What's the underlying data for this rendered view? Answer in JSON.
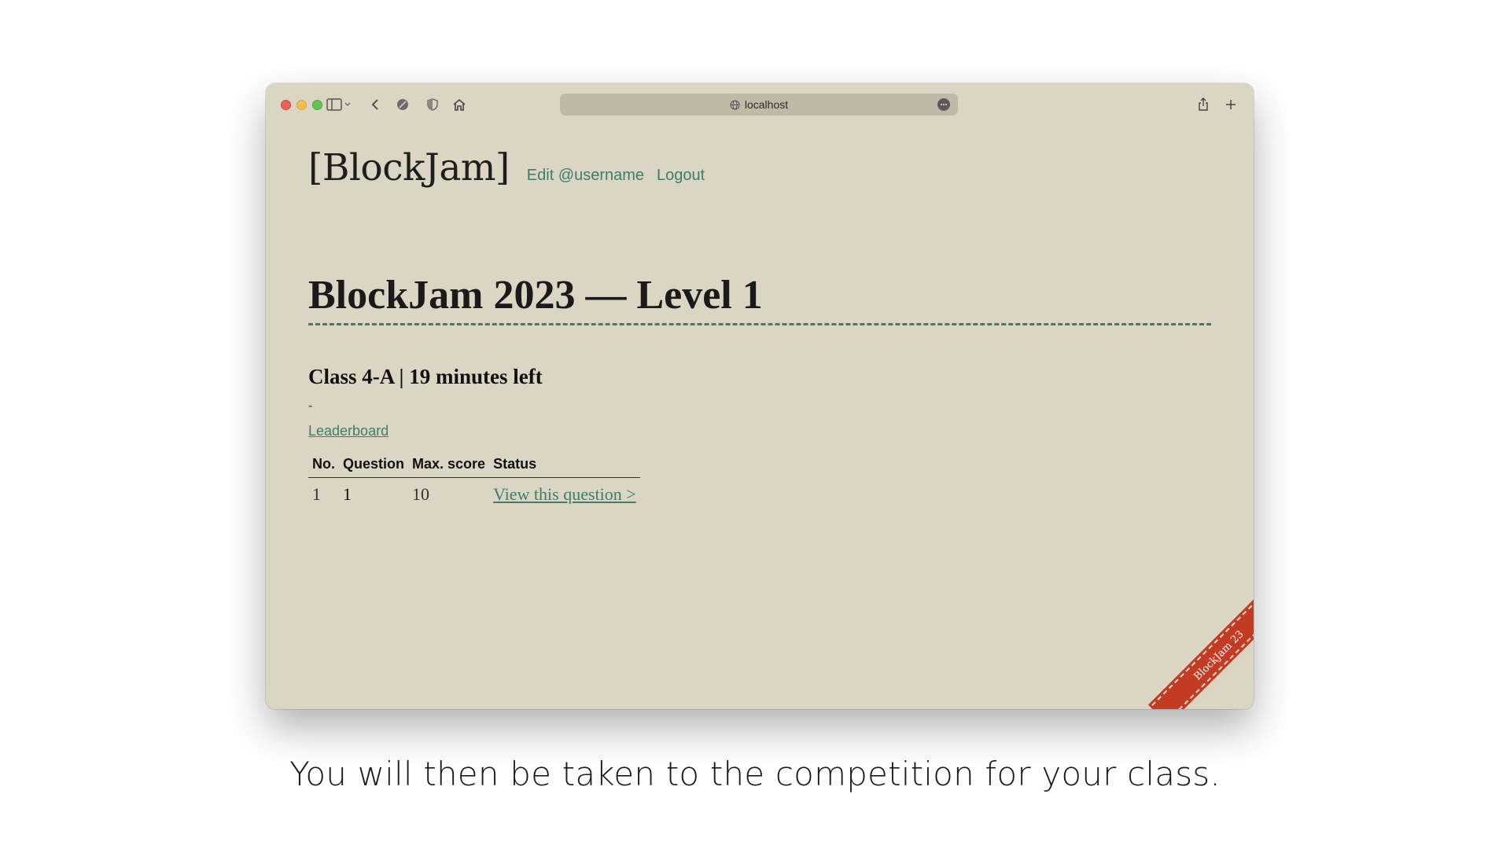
{
  "browser": {
    "address": "localhost",
    "icons": [
      "sidebar-icon",
      "chevron-down-icon",
      "back-icon",
      "blocked-icon",
      "shield-icon",
      "home-icon",
      "globe-icon",
      "more-icon",
      "share-icon",
      "plus-icon"
    ]
  },
  "site": {
    "logo": "[BlockJam]",
    "nav": [
      {
        "label": "Edit @username"
      },
      {
        "label": "Logout"
      }
    ]
  },
  "page": {
    "title": "BlockJam 2023 — Level 1",
    "subtitle": "Class 4-A | 19 minutes left",
    "dash": "-",
    "leaderboard_link": "Leaderboard",
    "table": {
      "headers": [
        "No.",
        "Question",
        "Max. score",
        "Status"
      ],
      "rows": [
        {
          "no": "1",
          "question": "1",
          "max_score": "10",
          "status": "View this question >"
        }
      ]
    }
  },
  "ribbon": {
    "text": "BlockJam 23",
    "color": "#c23b22"
  },
  "colors": {
    "accent": "#3e7d6c",
    "background": "#dad6c3"
  },
  "caption": "You will then be taken to the competition for your class."
}
